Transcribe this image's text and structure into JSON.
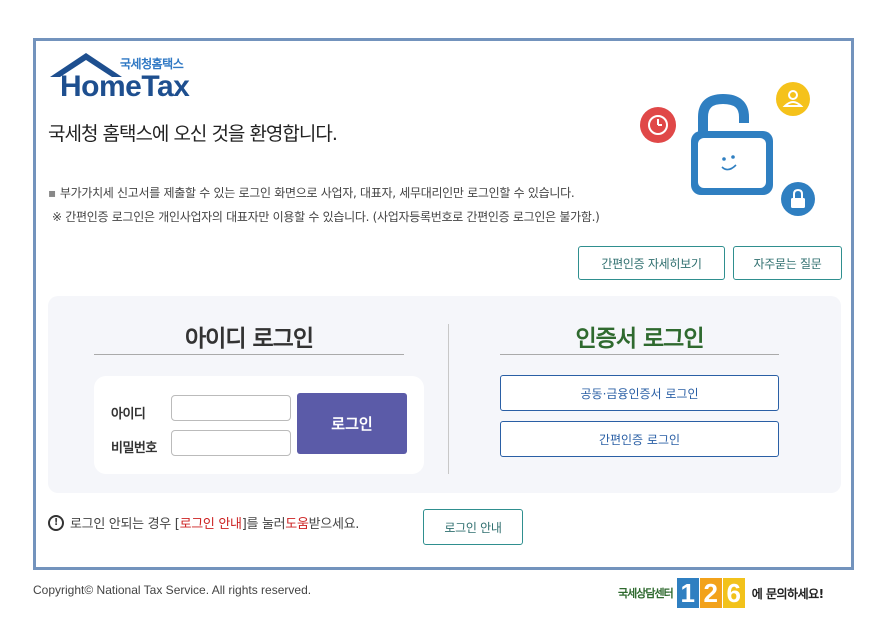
{
  "logo": {
    "korean": "국세청홈택스",
    "english": "HomeTax"
  },
  "welcome": "국세청 홈택스에 오신 것을 환영합니다.",
  "notices": [
    "부가가치세 신고서를 제출할 수 있는 로그인 화면으로 사업자, 대표자, 세무대리인만 로그인할 수 있습니다.",
    "※ 간편인증 로그인은 개인사업자의 대표자만 이용할 수 있습니다. (사업자등록번호로 간편인증 로그인은 불가함.)"
  ],
  "top_buttons": {
    "easy_auth_detail": "간편인증 자세히보기",
    "faq": "자주묻는 질문"
  },
  "id_login": {
    "title": "아이디 로그인",
    "id_label": "아이디",
    "password_label": "비밀번호",
    "id_value": "",
    "password_value": "",
    "login_button": "로그인"
  },
  "cert_login": {
    "title": "인증서 로그인",
    "joint_cert_button": "공동·금융인증서 로그인",
    "easy_auth_button": "간편인증 로그인"
  },
  "help": {
    "prefix": "로그인 안되는 경우 [",
    "link": "로그인 안내",
    "middle": "]를 눌러 ",
    "help_word": "도움",
    "suffix": "받으세요.",
    "guide_button": "로그인 안내"
  },
  "footer": {
    "copyright": "Copyright© National Tax Service. All rights reserved.",
    "call_center_label": "국세상담센터",
    "call_center_number": [
      "1",
      "2",
      "6"
    ],
    "call_center_tail": "에 문의하세요!"
  },
  "icons": [
    "house-roof-icon",
    "padlock-icon",
    "clock-icon",
    "user-icon",
    "small-lock-icon",
    "warning-icon"
  ],
  "colors": {
    "frame": "#7393bd",
    "brand_blue": "#1e4f8f",
    "login_button": "#5b5ba8",
    "cert_green": "#2f6a2f",
    "accent_red": "#c22"
  }
}
